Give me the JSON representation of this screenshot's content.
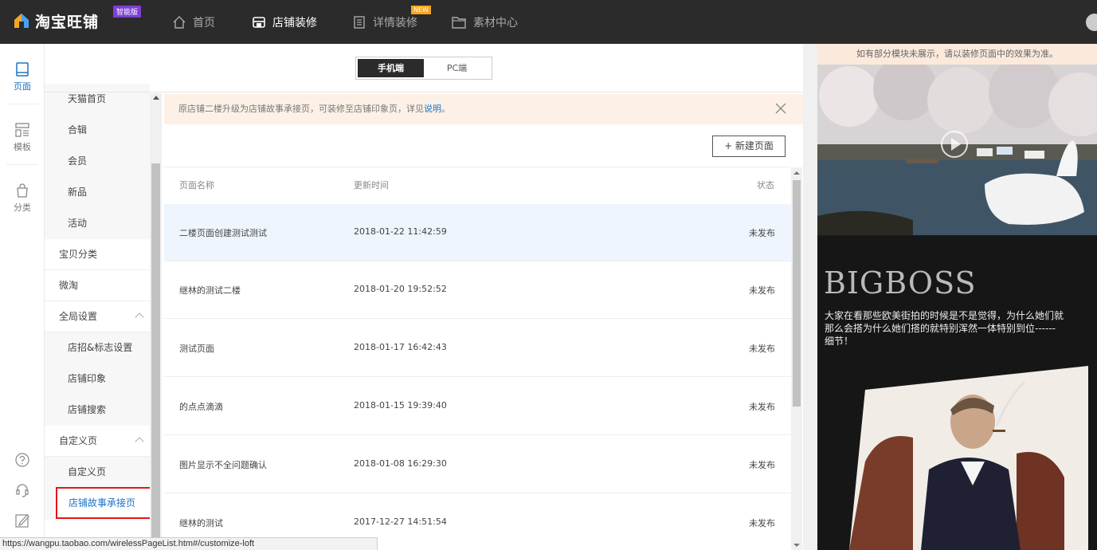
{
  "header": {
    "logo_text": "淘宝旺铺",
    "logo_badge": "智能版",
    "nav": [
      {
        "label": "首页",
        "icon": "home-icon"
      },
      {
        "label": "店铺装修",
        "icon": "store-icon"
      },
      {
        "label": "详情装修",
        "icon": "document-icon",
        "badge": "NEW"
      },
      {
        "label": "素材中心",
        "icon": "folder-icon"
      }
    ]
  },
  "rail": {
    "items": [
      {
        "label": "页面",
        "icon": "page-icon",
        "active": true
      },
      {
        "label": "模板",
        "icon": "template-icon"
      },
      {
        "label": "分类",
        "icon": "bag-icon"
      }
    ],
    "bottom_icons": [
      "help-icon",
      "headset-icon",
      "edit-icon"
    ]
  },
  "subnav": {
    "items": [
      {
        "label": "天猫首页",
        "type": "child"
      },
      {
        "label": "合辑",
        "type": "child"
      },
      {
        "label": "会员",
        "type": "child"
      },
      {
        "label": "新品",
        "type": "child"
      },
      {
        "label": "活动",
        "type": "child"
      },
      {
        "label": "宝贝分类",
        "type": "parent"
      },
      {
        "label": "微淘",
        "type": "parent"
      },
      {
        "label": "全局设置",
        "type": "parent",
        "expandable": true
      },
      {
        "label": "店招&标志设置",
        "type": "child"
      },
      {
        "label": "店铺印象",
        "type": "child"
      },
      {
        "label": "店铺搜索",
        "type": "child"
      },
      {
        "label": "自定义页",
        "type": "parent",
        "expandable": true
      },
      {
        "label": "自定义页",
        "type": "child"
      },
      {
        "label": "店铺故事承接页",
        "type": "child",
        "selected": true
      }
    ]
  },
  "toggle": {
    "mobile": "手机端",
    "pc": "PC端",
    "active": "mobile"
  },
  "notice": {
    "text": "原店铺二楼升级为店铺故事承接页，可装修至店铺印象页，详见",
    "link": "说明",
    "suffix": "。"
  },
  "new_page_button": "+ 新建页面",
  "table": {
    "headers": [
      "页面名称",
      "更新时间",
      "状态"
    ],
    "rows": [
      {
        "name": "二楼页面创建测试测试",
        "time": "2018-01-22 11:42:59",
        "status": "未发布",
        "highlighted": true
      },
      {
        "name": "继林的测试二楼",
        "time": "2018-01-20 19:52:52",
        "status": "未发布"
      },
      {
        "name": "测试页面",
        "time": "2018-01-17 16:42:43",
        "status": "未发布"
      },
      {
        "name": "的点点滴滴",
        "time": "2018-01-15 19:39:40",
        "status": "未发布"
      },
      {
        "name": "图片显示不全问题确认",
        "time": "2018-01-08 16:29:30",
        "status": "未发布"
      },
      {
        "name": "继林的测试",
        "time": "2017-12-27 14:51:54",
        "status": "未发布"
      }
    ]
  },
  "preview": {
    "note": "如有部分模块未展示，请以装修页面中的效果为准。",
    "brand": "BIGBOSS",
    "promo": "大家在看那些欧美街拍的时候是不是觉得，为什么她们就那么会搭为什么她们搭的就特别浑然一体特别到位------细节！"
  },
  "status_bar": "https://wangpu.taobao.com/wirelessPageList.htm#/customize-loft",
  "colors": {
    "accent": "#1a73c6",
    "topbar": "#2b2b2b",
    "highlight_border": "#e5151a"
  }
}
